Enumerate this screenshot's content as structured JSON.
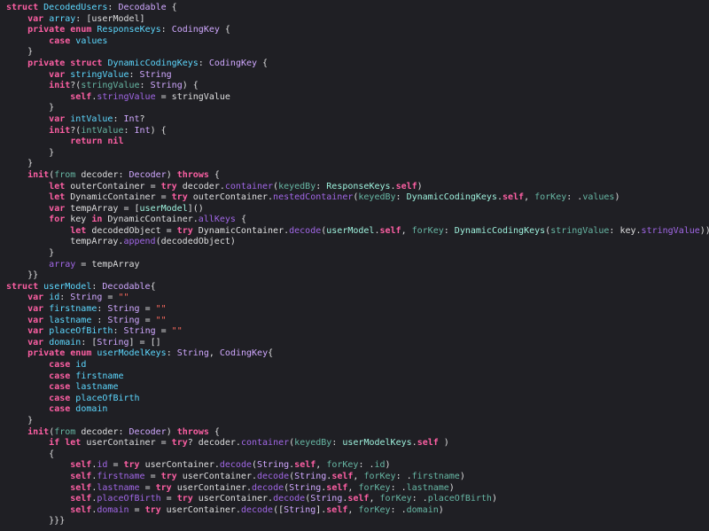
{
  "colors": {
    "background": "#1f1f24",
    "plain": "#dfdfe0",
    "keyword": "#fc5fa3",
    "type": "#d0a8ff",
    "declaration": "#5dd8ff",
    "property": "#a167e6",
    "function": "#67b7a4",
    "string": "#fc6a5d",
    "user_type": "#9ef1dd"
  },
  "code_lines": [
    [
      [
        "kw",
        "struct"
      ],
      [
        "p",
        " "
      ],
      [
        "decl",
        "DecodedUsers"
      ],
      [
        "p",
        ": "
      ],
      [
        "type",
        "Decodable"
      ],
      [
        "p",
        " {"
      ]
    ],
    [
      [
        "p",
        "    "
      ],
      [
        "kw",
        "var"
      ],
      [
        "p",
        " "
      ],
      [
        "decl",
        "array"
      ],
      [
        "p",
        ": ["
      ],
      [
        "p",
        "userModel"
      ],
      [
        "p",
        "]"
      ]
    ],
    [
      [
        "p",
        "    "
      ],
      [
        "kw",
        "private"
      ],
      [
        "p",
        " "
      ],
      [
        "kw",
        "enum"
      ],
      [
        "p",
        " "
      ],
      [
        "decl",
        "ResponseKeys"
      ],
      [
        "p",
        ": "
      ],
      [
        "type",
        "CodingKey"
      ],
      [
        "p",
        " {"
      ]
    ],
    [
      [
        "p",
        "        "
      ],
      [
        "kw",
        "case"
      ],
      [
        "p",
        " "
      ],
      [
        "decl",
        "values"
      ]
    ],
    [
      [
        "p",
        "    }"
      ]
    ],
    [
      [
        "p",
        "    "
      ],
      [
        "kw",
        "private"
      ],
      [
        "p",
        " "
      ],
      [
        "kw",
        "struct"
      ],
      [
        "p",
        " "
      ],
      [
        "decl",
        "DynamicCodingKeys"
      ],
      [
        "p",
        ": "
      ],
      [
        "type",
        "CodingKey"
      ],
      [
        "p",
        " {"
      ]
    ],
    [
      [
        "p",
        "        "
      ],
      [
        "kw",
        "var"
      ],
      [
        "p",
        " "
      ],
      [
        "decl",
        "stringValue"
      ],
      [
        "p",
        ": "
      ],
      [
        "type",
        "String"
      ]
    ],
    [
      [
        "p",
        "        "
      ],
      [
        "kw",
        "init"
      ],
      [
        "p",
        "?("
      ],
      [
        "fn",
        "stringValue"
      ],
      [
        "p",
        ": "
      ],
      [
        "type",
        "String"
      ],
      [
        "p",
        ") {"
      ]
    ],
    [
      [
        "p",
        "            "
      ],
      [
        "kw",
        "self"
      ],
      [
        "p",
        "."
      ],
      [
        "prop",
        "stringValue"
      ],
      [
        "p",
        " = stringValue"
      ]
    ],
    [
      [
        "p",
        "        }"
      ]
    ],
    [
      [
        "p",
        "        "
      ],
      [
        "kw",
        "var"
      ],
      [
        "p",
        " "
      ],
      [
        "decl",
        "intValue"
      ],
      [
        "p",
        ": "
      ],
      [
        "type",
        "Int"
      ],
      [
        "p",
        "?"
      ]
    ],
    [
      [
        "p",
        "        "
      ],
      [
        "kw",
        "init"
      ],
      [
        "p",
        "?("
      ],
      [
        "fn",
        "intValue"
      ],
      [
        "p",
        ": "
      ],
      [
        "type",
        "Int"
      ],
      [
        "p",
        ") {"
      ]
    ],
    [
      [
        "p",
        "            "
      ],
      [
        "kw",
        "return"
      ],
      [
        "p",
        " "
      ],
      [
        "kw",
        "nil"
      ]
    ],
    [
      [
        "p",
        "        }"
      ]
    ],
    [
      [
        "p",
        "    }"
      ]
    ],
    [
      [
        "p",
        "    "
      ],
      [
        "kw",
        "init"
      ],
      [
        "p",
        "("
      ],
      [
        "fn",
        "from"
      ],
      [
        "p",
        " decoder: "
      ],
      [
        "type",
        "Decoder"
      ],
      [
        "p",
        ") "
      ],
      [
        "kw",
        "throws"
      ],
      [
        "p",
        " {"
      ]
    ],
    [
      [
        "p",
        "        "
      ],
      [
        "kw",
        "let"
      ],
      [
        "p",
        " outerContainer = "
      ],
      [
        "kw",
        "try"
      ],
      [
        "p",
        " decoder."
      ],
      [
        "prop",
        "container"
      ],
      [
        "p",
        "("
      ],
      [
        "fn",
        "keyedBy"
      ],
      [
        "p",
        ": "
      ],
      [
        "usertype",
        "ResponseKeys"
      ],
      [
        "p",
        "."
      ],
      [
        "kw",
        "self"
      ],
      [
        "p",
        ")"
      ]
    ],
    [
      [
        "p",
        "        "
      ],
      [
        "kw",
        "let"
      ],
      [
        "p",
        " DynamicContainer = "
      ],
      [
        "kw",
        "try"
      ],
      [
        "p",
        " outerContainer."
      ],
      [
        "prop",
        "nestedContainer"
      ],
      [
        "p",
        "("
      ],
      [
        "fn",
        "keyedBy"
      ],
      [
        "p",
        ": "
      ],
      [
        "usertype",
        "DynamicCodingKeys"
      ],
      [
        "p",
        "."
      ],
      [
        "kw",
        "self"
      ],
      [
        "p",
        ", "
      ],
      [
        "fn",
        "forKey"
      ],
      [
        "p",
        ": ."
      ],
      [
        "fn",
        "values"
      ],
      [
        "p",
        ")"
      ]
    ],
    [
      [
        "p",
        "        "
      ],
      [
        "kw",
        "var"
      ],
      [
        "p",
        " tempArray = ["
      ],
      [
        "usertype",
        "userModel"
      ],
      [
        "p",
        "]()"
      ]
    ],
    [
      [
        "p",
        "        "
      ],
      [
        "kw",
        "for"
      ],
      [
        "p",
        " key "
      ],
      [
        "kw",
        "in"
      ],
      [
        "p",
        " DynamicContainer."
      ],
      [
        "prop",
        "allKeys"
      ],
      [
        "p",
        " {"
      ]
    ],
    [
      [
        "p",
        "            "
      ],
      [
        "kw",
        "let"
      ],
      [
        "p",
        " decodedObject = "
      ],
      [
        "kw",
        "try"
      ],
      [
        "p",
        " DynamicContainer."
      ],
      [
        "prop",
        "decode"
      ],
      [
        "p",
        "("
      ],
      [
        "usertype",
        "userModel"
      ],
      [
        "p",
        "."
      ],
      [
        "kw",
        "self"
      ],
      [
        "p",
        ", "
      ],
      [
        "fn",
        "forKey"
      ],
      [
        "p",
        ": "
      ],
      [
        "usertype",
        "DynamicCodingKeys"
      ],
      [
        "p",
        "("
      ],
      [
        "fn",
        "stringValue"
      ],
      [
        "p",
        ": key."
      ],
      [
        "prop",
        "stringValue"
      ],
      [
        "p",
        "))"
      ]
    ],
    [
      [
        "p",
        "            tempArray."
      ],
      [
        "prop",
        "append"
      ],
      [
        "p",
        "(decodedObject)"
      ]
    ],
    [
      [
        "p",
        "        }"
      ]
    ],
    [
      [
        "p",
        "        "
      ],
      [
        "prop",
        "array"
      ],
      [
        "p",
        " = tempArray"
      ]
    ],
    [
      [
        "p",
        "    }}"
      ]
    ],
    [
      [
        "kw",
        "struct"
      ],
      [
        "p",
        " "
      ],
      [
        "decl",
        "userModel"
      ],
      [
        "p",
        ": "
      ],
      [
        "type",
        "Decodable"
      ],
      [
        "p",
        "{"
      ]
    ],
    [
      [
        "p",
        "    "
      ],
      [
        "kw",
        "var"
      ],
      [
        "p",
        " "
      ],
      [
        "decl",
        "id"
      ],
      [
        "p",
        ": "
      ],
      [
        "type",
        "String"
      ],
      [
        "p",
        " = "
      ],
      [
        "str",
        "\"\""
      ]
    ],
    [
      [
        "p",
        "    "
      ],
      [
        "kw",
        "var"
      ],
      [
        "p",
        " "
      ],
      [
        "decl",
        "firstname"
      ],
      [
        "p",
        ": "
      ],
      [
        "type",
        "String"
      ],
      [
        "p",
        " = "
      ],
      [
        "str",
        "\"\""
      ]
    ],
    [
      [
        "p",
        "    "
      ],
      [
        "kw",
        "var"
      ],
      [
        "p",
        " "
      ],
      [
        "decl",
        "lastname"
      ],
      [
        "p",
        " : "
      ],
      [
        "type",
        "String"
      ],
      [
        "p",
        " = "
      ],
      [
        "str",
        "\"\""
      ]
    ],
    [
      [
        "p",
        "    "
      ],
      [
        "kw",
        "var"
      ],
      [
        "p",
        " "
      ],
      [
        "decl",
        "placeOfBirth"
      ],
      [
        "p",
        ": "
      ],
      [
        "type",
        "String"
      ],
      [
        "p",
        " = "
      ],
      [
        "str",
        "\"\""
      ]
    ],
    [
      [
        "p",
        "    "
      ],
      [
        "kw",
        "var"
      ],
      [
        "p",
        " "
      ],
      [
        "decl",
        "domain"
      ],
      [
        "p",
        ": ["
      ],
      [
        "type",
        "String"
      ],
      [
        "p",
        "] = []"
      ]
    ],
    [
      [
        "p",
        "    "
      ],
      [
        "kw",
        "private"
      ],
      [
        "p",
        " "
      ],
      [
        "kw",
        "enum"
      ],
      [
        "p",
        " "
      ],
      [
        "decl",
        "userModelKeys"
      ],
      [
        "p",
        ": "
      ],
      [
        "type",
        "String"
      ],
      [
        "p",
        ", "
      ],
      [
        "type",
        "CodingKey"
      ],
      [
        "p",
        "{"
      ]
    ],
    [
      [
        "p",
        "        "
      ],
      [
        "kw",
        "case"
      ],
      [
        "p",
        " "
      ],
      [
        "decl",
        "id"
      ]
    ],
    [
      [
        "p",
        "        "
      ],
      [
        "kw",
        "case"
      ],
      [
        "p",
        " "
      ],
      [
        "decl",
        "firstname"
      ]
    ],
    [
      [
        "p",
        "        "
      ],
      [
        "kw",
        "case"
      ],
      [
        "p",
        " "
      ],
      [
        "decl",
        "lastname"
      ]
    ],
    [
      [
        "p",
        "        "
      ],
      [
        "kw",
        "case"
      ],
      [
        "p",
        " "
      ],
      [
        "decl",
        "placeOfBirth"
      ]
    ],
    [
      [
        "p",
        "        "
      ],
      [
        "kw",
        "case"
      ],
      [
        "p",
        " "
      ],
      [
        "decl",
        "domain"
      ]
    ],
    [
      [
        "p",
        "    }"
      ]
    ],
    [
      [
        "p",
        "    "
      ],
      [
        "kw",
        "init"
      ],
      [
        "p",
        "("
      ],
      [
        "fn",
        "from"
      ],
      [
        "p",
        " decoder: "
      ],
      [
        "type",
        "Decoder"
      ],
      [
        "p",
        ") "
      ],
      [
        "kw",
        "throws"
      ],
      [
        "p",
        " {"
      ]
    ],
    [
      [
        "p",
        "        "
      ],
      [
        "kw",
        "if"
      ],
      [
        "p",
        " "
      ],
      [
        "kw",
        "let"
      ],
      [
        "p",
        " userContainer = "
      ],
      [
        "kw",
        "try"
      ],
      [
        "p",
        "? decoder."
      ],
      [
        "prop",
        "container"
      ],
      [
        "p",
        "("
      ],
      [
        "fn",
        "keyedBy"
      ],
      [
        "p",
        ": "
      ],
      [
        "usertype",
        "userModelKeys"
      ],
      [
        "p",
        "."
      ],
      [
        "kw",
        "self"
      ],
      [
        "p",
        " )"
      ]
    ],
    [
      [
        "p",
        "        {"
      ]
    ],
    [
      [
        "p",
        "            "
      ],
      [
        "kw",
        "self"
      ],
      [
        "p",
        "."
      ],
      [
        "prop",
        "id"
      ],
      [
        "p",
        " = "
      ],
      [
        "kw",
        "try"
      ],
      [
        "p",
        " userContainer."
      ],
      [
        "prop",
        "decode"
      ],
      [
        "p",
        "("
      ],
      [
        "type",
        "String"
      ],
      [
        "p",
        "."
      ],
      [
        "kw",
        "self"
      ],
      [
        "p",
        ", "
      ],
      [
        "fn",
        "forKey"
      ],
      [
        "p",
        ": ."
      ],
      [
        "fn",
        "id"
      ],
      [
        "p",
        ")"
      ]
    ],
    [
      [
        "p",
        "            "
      ],
      [
        "kw",
        "self"
      ],
      [
        "p",
        "."
      ],
      [
        "prop",
        "firstname"
      ],
      [
        "p",
        " = "
      ],
      [
        "kw",
        "try"
      ],
      [
        "p",
        " userContainer."
      ],
      [
        "prop",
        "decode"
      ],
      [
        "p",
        "("
      ],
      [
        "type",
        "String"
      ],
      [
        "p",
        "."
      ],
      [
        "kw",
        "self"
      ],
      [
        "p",
        ", "
      ],
      [
        "fn",
        "forKey"
      ],
      [
        "p",
        ": ."
      ],
      [
        "fn",
        "firstname"
      ],
      [
        "p",
        ")"
      ]
    ],
    [
      [
        "p",
        "            "
      ],
      [
        "kw",
        "self"
      ],
      [
        "p",
        "."
      ],
      [
        "prop",
        "lastname"
      ],
      [
        "p",
        " = "
      ],
      [
        "kw",
        "try"
      ],
      [
        "p",
        " userContainer."
      ],
      [
        "prop",
        "decode"
      ],
      [
        "p",
        "("
      ],
      [
        "type",
        "String"
      ],
      [
        "p",
        "."
      ],
      [
        "kw",
        "self"
      ],
      [
        "p",
        ", "
      ],
      [
        "fn",
        "forKey"
      ],
      [
        "p",
        ": ."
      ],
      [
        "fn",
        "lastname"
      ],
      [
        "p",
        ")"
      ]
    ],
    [
      [
        "p",
        "            "
      ],
      [
        "kw",
        "self"
      ],
      [
        "p",
        "."
      ],
      [
        "prop",
        "placeOfBirth"
      ],
      [
        "p",
        " = "
      ],
      [
        "kw",
        "try"
      ],
      [
        "p",
        " userContainer."
      ],
      [
        "prop",
        "decode"
      ],
      [
        "p",
        "("
      ],
      [
        "type",
        "String"
      ],
      [
        "p",
        "."
      ],
      [
        "kw",
        "self"
      ],
      [
        "p",
        ", "
      ],
      [
        "fn",
        "forKey"
      ],
      [
        "p",
        ": ."
      ],
      [
        "fn",
        "placeOfBirth"
      ],
      [
        "p",
        ")"
      ]
    ],
    [
      [
        "p",
        "            "
      ],
      [
        "kw",
        "self"
      ],
      [
        "p",
        "."
      ],
      [
        "prop",
        "domain"
      ],
      [
        "p",
        " = "
      ],
      [
        "kw",
        "try"
      ],
      [
        "p",
        " userContainer."
      ],
      [
        "prop",
        "decode"
      ],
      [
        "p",
        "(["
      ],
      [
        "type",
        "String"
      ],
      [
        "p",
        "]."
      ],
      [
        "kw",
        "self"
      ],
      [
        "p",
        ", "
      ],
      [
        "fn",
        "forKey"
      ],
      [
        "p",
        ": ."
      ],
      [
        "fn",
        "domain"
      ],
      [
        "p",
        ")"
      ]
    ],
    [
      [
        "p",
        "        }}}"
      ]
    ]
  ]
}
